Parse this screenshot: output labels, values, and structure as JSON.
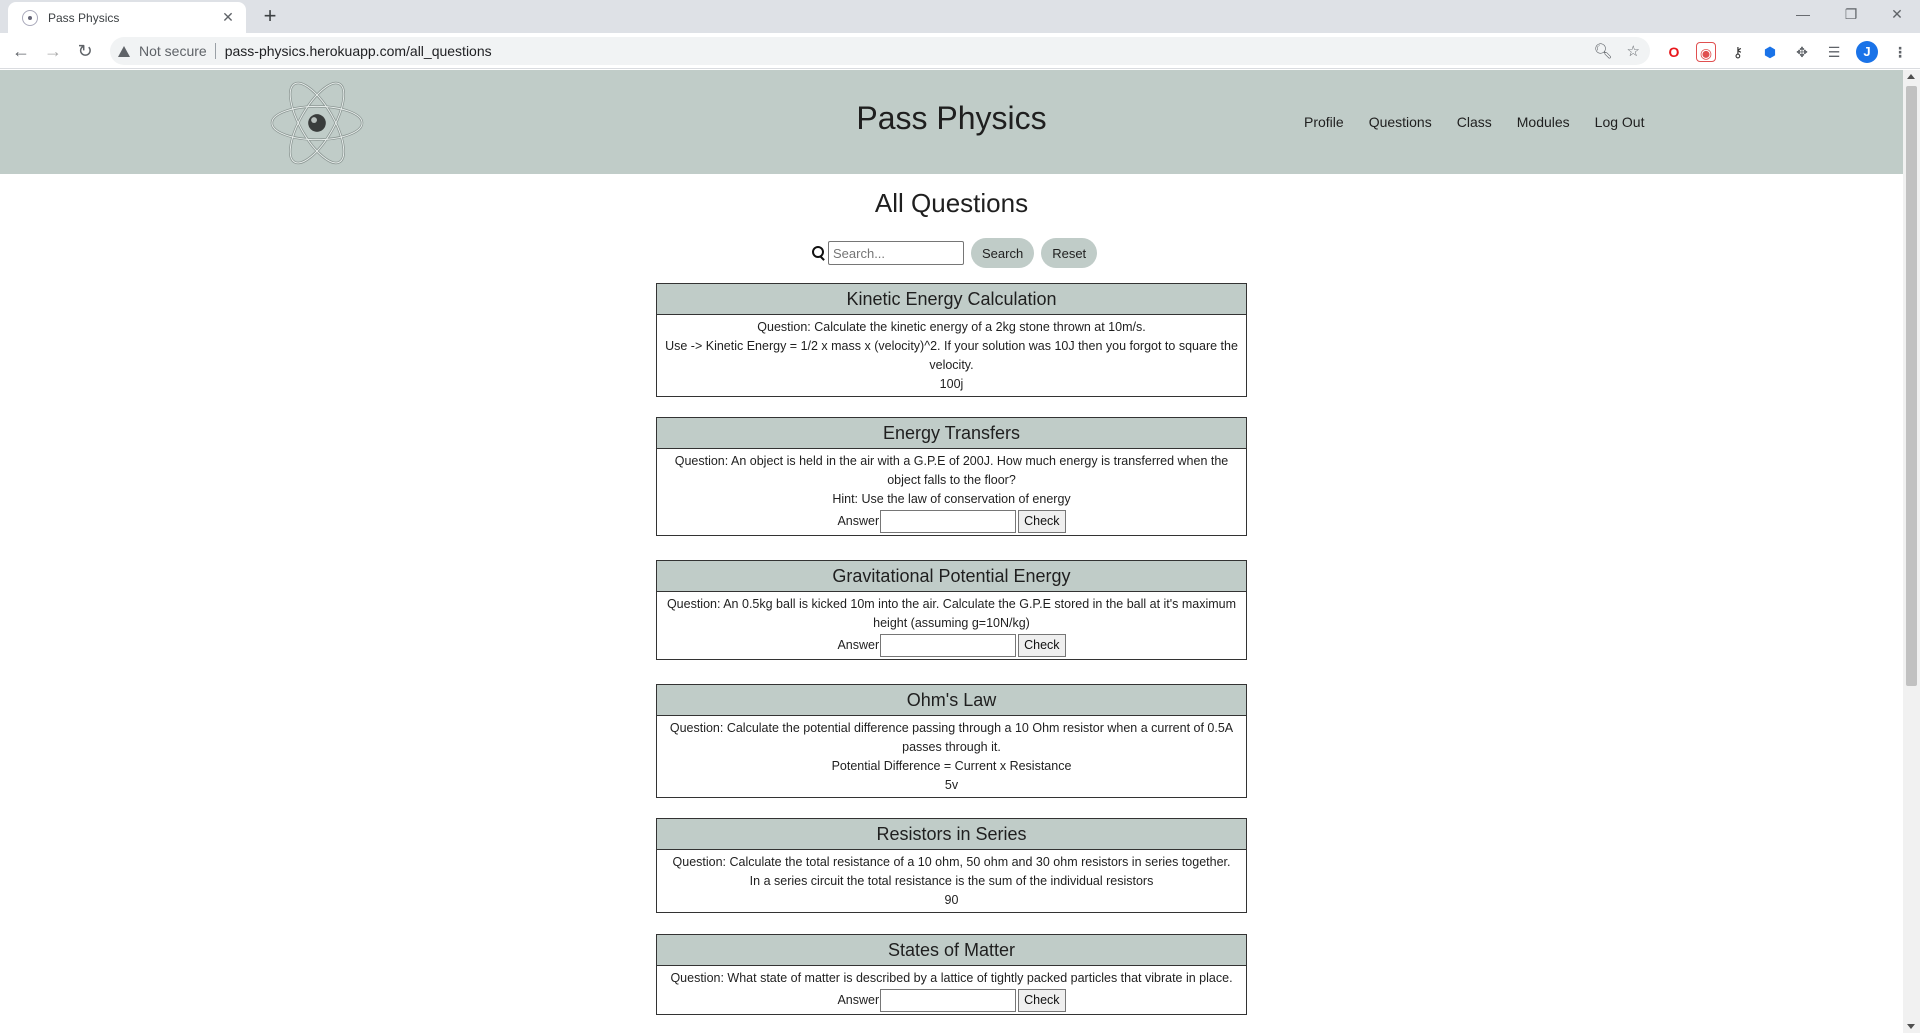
{
  "browser": {
    "tab_title": "Pass Physics",
    "tab_close": "✕",
    "new_tab": "+",
    "security_label": "Not secure",
    "url": "pass-physics.herokuapp.com/all_questions",
    "profile_initial": "J"
  },
  "header": {
    "title": "Pass Physics",
    "nav": [
      "Profile",
      "Questions",
      "Class",
      "Modules",
      "Log Out"
    ]
  },
  "main": {
    "heading": "All Questions",
    "search_placeholder": "Search...",
    "search_button": "Search",
    "reset_button": "Reset",
    "answer_label": "Answer",
    "check_button": "Check"
  },
  "questions": [
    {
      "title": "Kinetic Energy Calculation",
      "lines": [
        "Question: Calculate the kinetic energy of a 2kg stone thrown at 10m/s.",
        "Use -> Kinetic Energy = 1/2 x mass x (velocity)^2. If your solution was 10J then you forgot to square the velocity.",
        "100j"
      ]
    },
    {
      "title": "Energy Transfers",
      "lines": [
        "Question: An object is held in the air with a G.P.E of 200J. How much energy is transferred when the object falls to the floor?",
        "Hint: Use the law of conservation of energy"
      ]
    },
    {
      "title": "Gravitational Potential Energy",
      "lines": [
        "Question: An 0.5kg ball is kicked 10m into the air. Calculate the G.P.E stored in the ball at it's maximum height (assuming g=10N/kg)"
      ]
    },
    {
      "title": "Ohm's Law",
      "lines": [
        "Question: Calculate the potential difference passing through a 10 Ohm resistor when a current of 0.5A passes through it.",
        "Potential Difference = Current x Resistance",
        "5v"
      ]
    },
    {
      "title": "Resistors in Series",
      "lines": [
        "Question: Calculate the total resistance of a 10 ohm, 50 ohm and 30 ohm resistors in series together.",
        "In a series circuit the total resistance is the sum of the individual resistors",
        "90"
      ]
    },
    {
      "title": "States of Matter",
      "lines": [
        "Question: What state of matter is described by a lattice of tightly packed particles that vibrate in place."
      ]
    }
  ]
}
